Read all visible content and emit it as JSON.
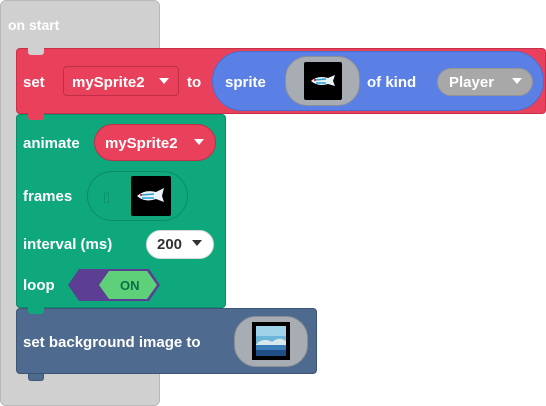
{
  "on_start": {
    "label": "on start"
  },
  "set_sprite": {
    "set_label": "set",
    "variable": "mySprite2",
    "to_label": "to",
    "sprite_label": "sprite",
    "of_kind_label": "of kind",
    "kind": "Player"
  },
  "animate": {
    "label": "animate",
    "variable": "mySprite2",
    "frames_label": "frames",
    "interval_label": "interval (ms)",
    "interval_value": "200",
    "loop_label": "loop",
    "loop_toggle": "ON"
  },
  "background": {
    "label": "set background image to"
  },
  "colors": {
    "sprites": "#e9415c",
    "animation": "#0fa77c",
    "scene": "#4f6a8f",
    "sprite_pill": "#5b80e5",
    "loops": "#d0d0d0"
  }
}
